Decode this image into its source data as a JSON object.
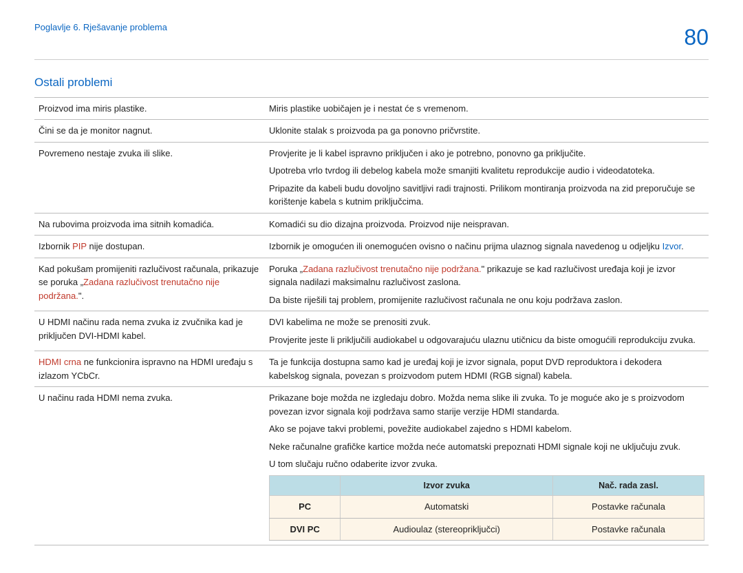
{
  "header": {
    "chapter": "Poglavlje 6. Rješavanje problema",
    "page": "80"
  },
  "section_title": "Ostali problemi",
  "rows": [
    {
      "issue": "Proizvod ima miris plastike.",
      "desc": "Miris plastike uobičajen je i nestat će s vremenom."
    },
    {
      "issue": "Čini se da je monitor nagnut.",
      "desc": "Uklonite stalak s proizvoda pa ga ponovno pričvrstite."
    },
    {
      "issue": "Povremeno nestaje zvuka ili slike.",
      "desc_paras": [
        "Provjerite je li kabel ispravno priključen i ako je potrebno, ponovno ga priključite.",
        "Upotreba vrlo tvrdog ili debelog kabela može smanjiti kvalitetu reprodukcije audio i videodatoteka.",
        "Pripazite da kabeli budu dovoljno savitljivi radi trajnosti. Prilikom montiranja proizvoda na zid preporučuje se korištenje kabela s kutnim priključcima."
      ]
    },
    {
      "issue": "Na rubovima proizvoda ima sitnih komadića.",
      "desc": "Komadići su dio dizajna proizvoda. Proizvod nije neispravan."
    },
    {
      "issue_pre": "Izbornik ",
      "issue_red": "PIP",
      "issue_post": " nije dostupan.",
      "desc_pre": "Izbornik je omogućen ili onemogućen ovisno o načinu prijma ulaznog signala navedenog u odjeljku ",
      "desc_link": "Izvor",
      "desc_post": "."
    },
    {
      "issue_pre2_a": "Kad pokušam promijeniti razlučivost računala, prikazuje se poruka „",
      "issue_red2": "Zadana razlučivost trenutačno nije podržana.",
      "issue_post2": "\".",
      "desc_paras": [
        "Poruka „Zadana razlučivost trenutačno nije podržana.\" prikazuje se kad razlučivost uređaja koji je izvor signala nadilazi maksimalnu razlučivost zaslona.",
        "Da biste riješili taj problem, promijenite razlučivost računala ne onu koju podržava zaslon."
      ],
      "desc_has_red_inline": true,
      "desc_red_inline": "Zadana razlučivost trenutačno nije podržana."
    },
    {
      "issue": "U HDMI načinu rada nema zvuka iz zvučnika kad je priključen DVI-HDMI kabel.",
      "desc_paras": [
        "DVI kabelima ne može se prenositi zvuk.",
        "Provjerite jeste li priključili audiokabel u odgovarajuću ulaznu utičnicu da biste omogućili reprodukciju zvuka."
      ]
    },
    {
      "issue_red3": "HDMI crna",
      "issue_post3": " ne funkcionira ispravno na HDMI uređaju s izlazom YCbCr.",
      "desc": "Ta je funkcija dostupna samo kad je uređaj koji je izvor signala, poput DVD reproduktora i dekodera kabelskog signala, povezan s proizvodom putem HDMI (RGB signal) kabela."
    },
    {
      "issue": "U načinu rada HDMI nema zvuka.",
      "desc_paras_last": [
        "Prikazane boje možda ne izgledaju dobro. Možda nema slike ili zvuka. To je moguće ako je s proizvodom povezan izvor signala koji podržava samo starije verzije HDMI standarda.",
        "Ako se pojave takvi problemi, povežite audiokabel zajedno s HDMI kabelom.",
        "Neke računalne grafičke kartice možda neće automatski prepoznati HDMI signale koji ne uključuju zvuk.",
        "U tom slučaju ručno odaberite izvor zvuka."
      ]
    }
  ],
  "sub_table": {
    "headers": [
      "",
      "Izvor zvuka",
      "Nač. rada zasl."
    ],
    "rows": [
      [
        "PC",
        "Automatski",
        "Postavke računala"
      ],
      [
        "DVI PC",
        "Audioulaz (stereopriključci)",
        "Postavke računala"
      ]
    ]
  }
}
